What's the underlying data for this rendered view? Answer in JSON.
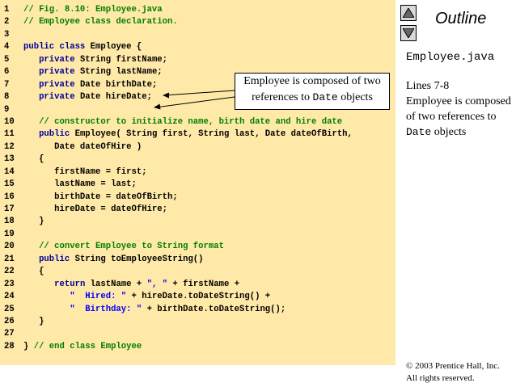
{
  "code_lines": [
    {
      "num": "1",
      "parts": [
        {
          "t": "// Fig. 8.10: Employee.java",
          "c": "cm"
        }
      ]
    },
    {
      "num": "2",
      "parts": [
        {
          "t": "// Employee class declaration.",
          "c": "cm"
        }
      ]
    },
    {
      "num": "3",
      "parts": []
    },
    {
      "num": "4",
      "parts": [
        {
          "t": "public class",
          "c": "kw"
        },
        {
          "t": " Employee {",
          "c": ""
        }
      ]
    },
    {
      "num": "5",
      "parts": [
        {
          "t": "   ",
          "c": ""
        },
        {
          "t": "private",
          "c": "kw"
        },
        {
          "t": " String firstName;",
          "c": ""
        }
      ]
    },
    {
      "num": "6",
      "parts": [
        {
          "t": "   ",
          "c": ""
        },
        {
          "t": "private",
          "c": "kw"
        },
        {
          "t": " String lastName;",
          "c": ""
        }
      ]
    },
    {
      "num": "7",
      "parts": [
        {
          "t": "   ",
          "c": ""
        },
        {
          "t": "private",
          "c": "kw"
        },
        {
          "t": " Date birthDate;",
          "c": ""
        }
      ]
    },
    {
      "num": "8",
      "parts": [
        {
          "t": "   ",
          "c": ""
        },
        {
          "t": "private",
          "c": "kw"
        },
        {
          "t": " Date hireDate;",
          "c": ""
        }
      ]
    },
    {
      "num": "9",
      "parts": []
    },
    {
      "num": "10",
      "parts": [
        {
          "t": "   // constructor to initialize name, birth date and hire date",
          "c": "cm"
        }
      ]
    },
    {
      "num": "11",
      "parts": [
        {
          "t": "   ",
          "c": ""
        },
        {
          "t": "public",
          "c": "kw"
        },
        {
          "t": " Employee( String first, String last, Date dateOfBirth,",
          "c": ""
        }
      ]
    },
    {
      "num": "12",
      "parts": [
        {
          "t": "      Date dateOfHire )",
          "c": ""
        }
      ]
    },
    {
      "num": "13",
      "parts": [
        {
          "t": "   {",
          "c": ""
        }
      ]
    },
    {
      "num": "14",
      "parts": [
        {
          "t": "      firstName = first;",
          "c": ""
        }
      ]
    },
    {
      "num": "15",
      "parts": [
        {
          "t": "      lastName = last;",
          "c": ""
        }
      ]
    },
    {
      "num": "16",
      "parts": [
        {
          "t": "      birthDate = dateOfBirth;",
          "c": ""
        }
      ]
    },
    {
      "num": "17",
      "parts": [
        {
          "t": "      hireDate = dateOfHire;",
          "c": ""
        }
      ]
    },
    {
      "num": "18",
      "parts": [
        {
          "t": "   }",
          "c": ""
        }
      ]
    },
    {
      "num": "19",
      "parts": []
    },
    {
      "num": "20",
      "parts": [
        {
          "t": "   // convert Employee to String format",
          "c": "cm"
        }
      ]
    },
    {
      "num": "21",
      "parts": [
        {
          "t": "   ",
          "c": ""
        },
        {
          "t": "public",
          "c": "kw"
        },
        {
          "t": " String toEmployeeString()",
          "c": ""
        }
      ]
    },
    {
      "num": "22",
      "parts": [
        {
          "t": "   {",
          "c": ""
        }
      ]
    },
    {
      "num": "23",
      "parts": [
        {
          "t": "      ",
          "c": ""
        },
        {
          "t": "return",
          "c": "kw"
        },
        {
          "t": " lastName + ",
          "c": ""
        },
        {
          "t": "\", \"",
          "c": "st"
        },
        {
          "t": " + firstName +",
          "c": ""
        }
      ]
    },
    {
      "num": "24",
      "parts": [
        {
          "t": "         ",
          "c": ""
        },
        {
          "t": "\"  Hired: \"",
          "c": "st"
        },
        {
          "t": " + hireDate.toDateString() +",
          "c": ""
        }
      ]
    },
    {
      "num": "25",
      "parts": [
        {
          "t": "         ",
          "c": ""
        },
        {
          "t": "\"  Birthday: \"",
          "c": "st"
        },
        {
          "t": " + birthDate.toDateString();",
          "c": ""
        }
      ]
    },
    {
      "num": "26",
      "parts": [
        {
          "t": "   }",
          "c": ""
        }
      ]
    },
    {
      "num": "27",
      "parts": []
    },
    {
      "num": "28",
      "parts": [
        {
          "t": "} ",
          "c": ""
        },
        {
          "t": "// end class Employee",
          "c": "cm"
        }
      ]
    }
  ],
  "callout": {
    "line1": "Employee is composed of two",
    "line2_prefix": "references to ",
    "line2_mono": "Date",
    "line2_suffix": " objects"
  },
  "nav": {
    "up_icon": "triangle-up-icon",
    "down_icon": "triangle-down-icon"
  },
  "sidebar": {
    "title": "Outline",
    "file_name": "Employee.java",
    "note_lines": "Lines 7-8",
    "note_text": "Employee is composed of two references to ",
    "note_mono": "Date",
    "note_suffix": " objects"
  },
  "footer": {
    "copyright": "© 2003 Prentice Hall, Inc.",
    "rights": "All rights reserved."
  },
  "colors": {
    "panel_bg": "#ffe9a8",
    "keyword": "#000099",
    "comment": "#008000",
    "string": "#0000ff"
  }
}
